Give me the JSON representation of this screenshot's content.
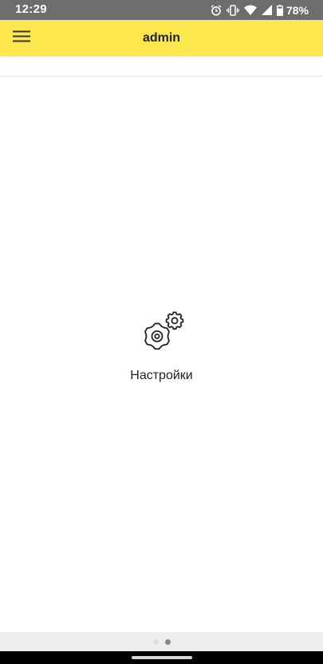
{
  "status_bar": {
    "time": "12:29",
    "battery_percent": "78%",
    "icons": [
      "alarm-icon",
      "vibrate-icon",
      "wifi-icon",
      "cell-signal-icon",
      "battery-icon"
    ]
  },
  "app_bar": {
    "title": "admin",
    "menu_icon": "hamburger-menu-icon",
    "background": "#fde74f"
  },
  "main": {
    "tile": {
      "icon": "gears-icon",
      "label": "Настройки"
    }
  },
  "pager": {
    "total_pages": 2,
    "current_page": 2
  }
}
